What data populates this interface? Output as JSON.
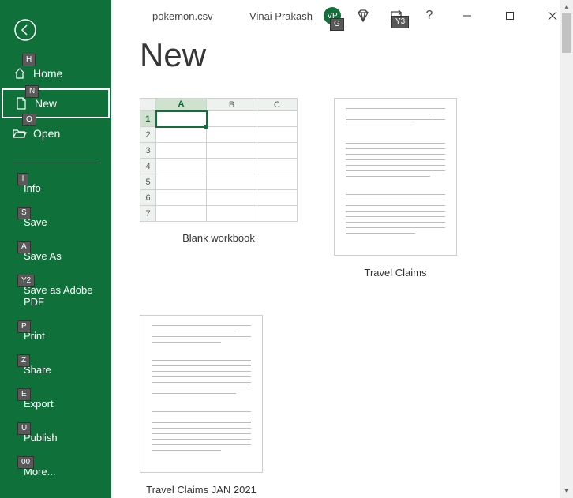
{
  "titlebar": {
    "filename": "pokemon.csv",
    "username": "Vinai Prakash",
    "avatar_initials": "VP",
    "avatar_tip": "G",
    "share_tip": "Y3"
  },
  "heading": "New",
  "sidebar": {
    "primary": [
      {
        "key": "home",
        "label": "Home",
        "tip": "H"
      },
      {
        "key": "new",
        "label": "New",
        "tip": "N",
        "selected": true
      },
      {
        "key": "open",
        "label": "Open",
        "tip": "O"
      }
    ],
    "secondary": [
      {
        "key": "info",
        "label": "Info",
        "tip": "I"
      },
      {
        "key": "save",
        "label": "Save",
        "tip": "S"
      },
      {
        "key": "saveas",
        "label": "Save As",
        "tip": "A"
      },
      {
        "key": "adobepdf",
        "label": "Save as Adobe PDF",
        "tip": "Y2"
      },
      {
        "key": "print",
        "label": "Print",
        "tip": "P"
      },
      {
        "key": "share",
        "label": "Share",
        "tip": "Z"
      },
      {
        "key": "export",
        "label": "Export",
        "tip": "E"
      },
      {
        "key": "publish",
        "label": "Publish",
        "tip": "U"
      },
      {
        "key": "more",
        "label": "More...",
        "tip": "00"
      }
    ]
  },
  "blank_template": {
    "caption": "Blank workbook",
    "columns": [
      "A",
      "B",
      "C"
    ],
    "rows": [
      "1",
      "2",
      "3",
      "4",
      "5",
      "6",
      "7"
    ]
  },
  "templates": [
    {
      "caption": "Travel Claims"
    },
    {
      "caption": "Travel Claims JAN 2021"
    }
  ]
}
